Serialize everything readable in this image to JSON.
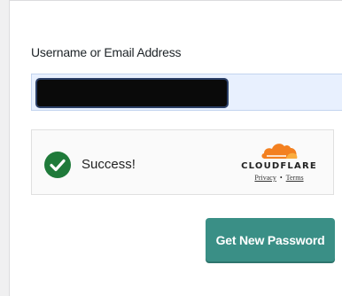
{
  "form": {
    "username_label": "Username or Email Address",
    "username_value": "",
    "submit_label": "Get New Password"
  },
  "turnstile": {
    "status_text": "Success!",
    "brand": "CLOUDFLARE",
    "privacy_link": "Privacy",
    "separator": "•",
    "terms_link": "Terms"
  },
  "colors": {
    "button": "#3a8f86",
    "success_check": "#1f7a3a",
    "cloudflare_orange": "#f38020",
    "input_autofill_bg": "#e8f0fe"
  },
  "icons": {
    "success": "check-circle-icon",
    "brand": "cloudflare-cloud-icon"
  }
}
